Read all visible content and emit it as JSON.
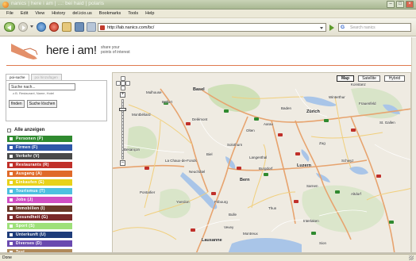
{
  "window": {
    "title": "nanics | here i am | ...: bei haid | polaris"
  },
  "menu": [
    "File",
    "Edit",
    "View",
    "History",
    "del.icio.us",
    "Bookmarks",
    "Tools",
    "Help"
  ],
  "urlbar": {
    "url": "http://lab.nanics.com/bc/",
    "search_placeholder": "Search nanics"
  },
  "page": {
    "logo": "here i am!",
    "slogan_line1": "share your",
    "slogan_line2": "points of interest",
    "tabs": [
      "poi-suche",
      "poi hinzufügen"
    ],
    "search_value": "Suche nach...",
    "search_hint": "z.B. Restaurant, Name, Hotel",
    "find_label": "finden",
    "clear_label": "Suche löschen",
    "show_all_label": "Alle anzeigen",
    "categories": [
      {
        "label": "Personen (P)",
        "color": "#2f8a2f"
      },
      {
        "label": "Firmen (F)",
        "color": "#2f57a8"
      },
      {
        "label": "Verkehr (V)",
        "color": "#4a4a4a"
      },
      {
        "label": "Restaurants (R)",
        "color": "#c0302a"
      },
      {
        "label": "Ausgang (A)",
        "color": "#e06a2a"
      },
      {
        "label": "Einkaufen (E)",
        "color": "#e8d21a"
      },
      {
        "label": "Tourismus (T)",
        "color": "#4ec0e0"
      },
      {
        "label": "Jobs (J)",
        "color": "#d04fc4"
      },
      {
        "label": "Immobilien (I)",
        "color": "#6a3a2a"
      },
      {
        "label": "Gesundheit (G)",
        "color": "#7a2a2a"
      },
      {
        "label": "Sport (S)",
        "color": "#9ee07a"
      },
      {
        "label": "Unterkunft (U)",
        "color": "#1e3c7a"
      },
      {
        "label": "Diverses (D)",
        "color": "#6a4ab0"
      },
      {
        "label": "Test",
        "color": "#b08a5a"
      }
    ]
  },
  "map": {
    "types": [
      "Map",
      "Satellite",
      "Hybrid"
    ],
    "active_type": "Map",
    "places": [
      "Basel",
      "Mulhouse",
      "Zürich",
      "Baden",
      "Aarau",
      "Olten",
      "Luzern",
      "Solothurn",
      "Biel",
      "Bern",
      "Thun",
      "Neuchâtel",
      "Fribourg",
      "Lausanne",
      "Besançon",
      "Pontarlier",
      "Montbéliard",
      "Delémont",
      "La Chaux-de-Fonds",
      "Yverdon",
      "Interlaken",
      "Zug",
      "Schwyz",
      "Altdorf",
      "Sarnen",
      "Belfort",
      "Winterthur",
      "Montreux",
      "Vevey",
      "Sion",
      "Bulle",
      "Langenthal",
      "Burgdorf",
      "Konstanz",
      "St. Gallen",
      "Frauenfeld"
    ]
  },
  "status": {
    "text": "Done"
  }
}
